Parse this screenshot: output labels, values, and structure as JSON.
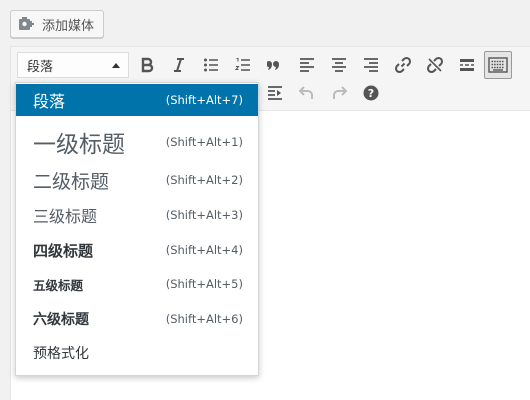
{
  "media": {
    "add_media_label": "添加媒体"
  },
  "toolbar": {
    "format_select_value": "段落",
    "buttons": [
      "bold-icon",
      "italic-icon",
      "bulleted-list-icon",
      "numbered-list-icon",
      "blockquote-icon",
      "align-left-icon",
      "align-center-icon",
      "align-right-icon",
      "insert-link-icon",
      "remove-link-icon",
      "read-more-icon",
      "toolbar-toggle-icon",
      "indent-icon",
      "undo-icon",
      "redo-icon",
      "help-icon"
    ]
  },
  "format_menu": {
    "items": [
      {
        "label": "段落",
        "shortcut": "(Shift+Alt+7)",
        "selected": true
      },
      {
        "label": "一级标题",
        "shortcut": "(Shift+Alt+1)"
      },
      {
        "label": "二级标题",
        "shortcut": "(Shift+Alt+2)"
      },
      {
        "label": "三级标题",
        "shortcut": "(Shift+Alt+3)"
      },
      {
        "label": "四级标题",
        "shortcut": "(Shift+Alt+4)"
      },
      {
        "label": "五级标题",
        "shortcut": "(Shift+Alt+5)"
      },
      {
        "label": "六级标题",
        "shortcut": "(Shift+Alt+6)"
      },
      {
        "label": "预格式化",
        "shortcut": ""
      }
    ]
  },
  "colors": {
    "selected_bg": "#0073aa",
    "toolbar_bg": "#f5f5f5",
    "page_bg": "#f1f1f1"
  }
}
